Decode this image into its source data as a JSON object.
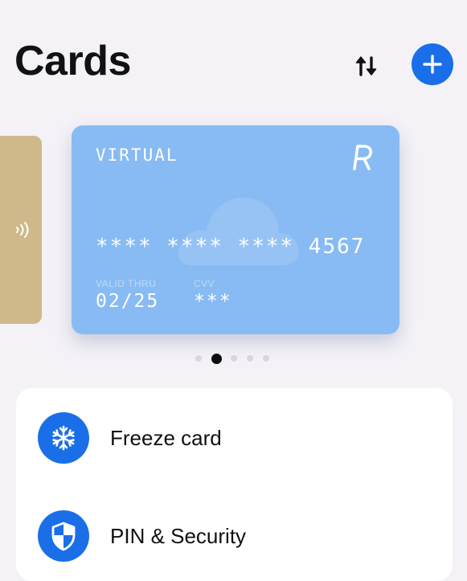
{
  "header": {
    "title": "Cards",
    "sort_icon": "sort-arrows-icon",
    "add_icon": "plus-icon"
  },
  "cards": [
    {
      "style": "gold",
      "icon": "contactless-icon",
      "color": "#cfb98a"
    },
    {
      "style": "virtual",
      "type_label": "VIRTUAL",
      "brand_icon": "revolut-r-logo",
      "number": "**** **** **** 4567",
      "valid_thru_label": "VALID THRU",
      "valid_thru": "02/25",
      "cvv_label": "CVV",
      "cvv": "***",
      "color": "#88bbf3"
    }
  ],
  "pagination": {
    "count": 5,
    "active_index": 1
  },
  "actions": [
    {
      "label": "Freeze card",
      "icon": "snowflake-icon"
    },
    {
      "label": "PIN & Security",
      "icon": "shield-icon"
    }
  ],
  "colors": {
    "accent": "#1a6fe8",
    "background": "#f4f2f7"
  }
}
